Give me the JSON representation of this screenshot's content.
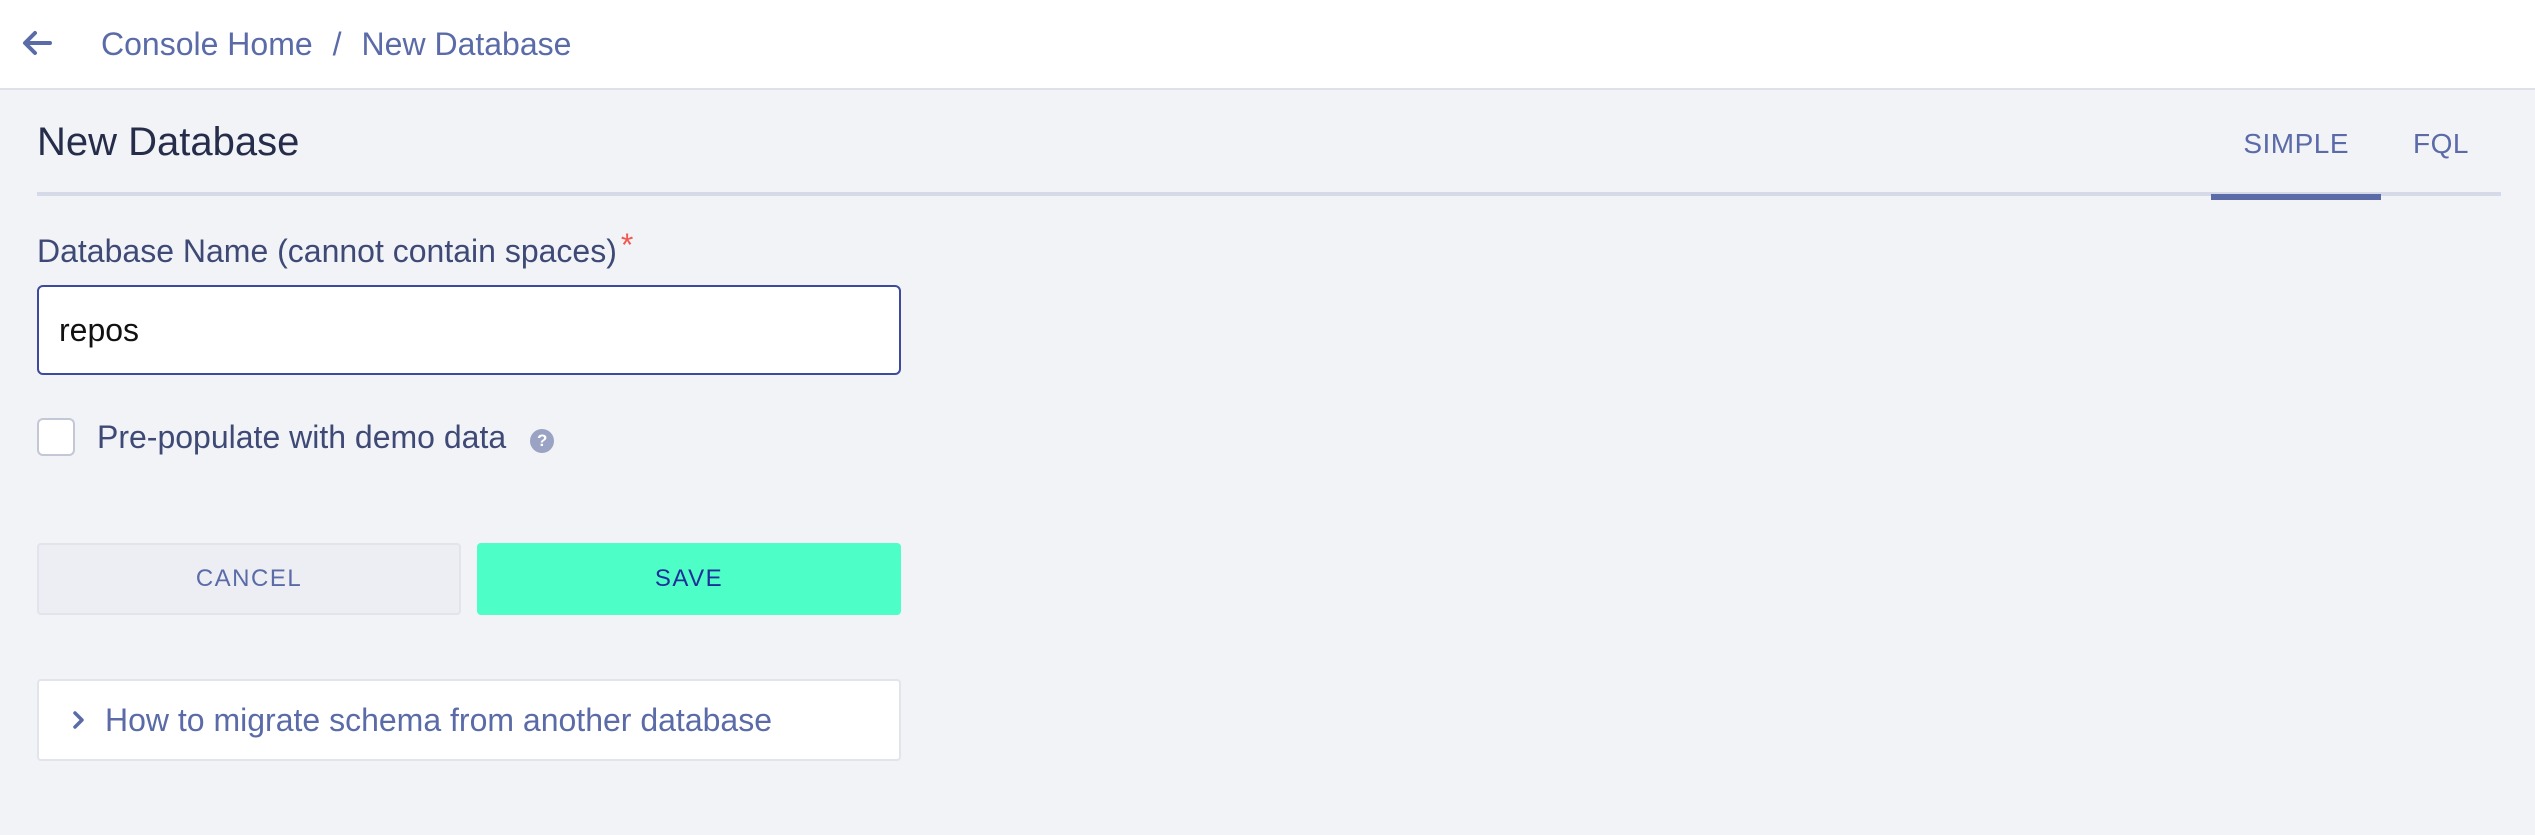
{
  "header": {
    "back_icon": "arrow-left-icon",
    "breadcrumb": {
      "home": "Console Home",
      "separator": "/",
      "current": "New Database"
    }
  },
  "page": {
    "title": "New Database",
    "tabs": [
      {
        "label": "SIMPLE",
        "active": true
      },
      {
        "label": "FQL",
        "active": false
      }
    ]
  },
  "form": {
    "name_label": "Database Name (cannot contain spaces)",
    "required_mark": "*",
    "name_value": "repos",
    "demo_checkbox_label": "Pre-populate with demo data",
    "demo_checked": false,
    "help_icon": "question-circle-icon",
    "help_glyph": "?",
    "cancel_label": "CANCEL",
    "save_label": "SAVE"
  },
  "accordion": {
    "icon": "chevron-right-icon",
    "label": "How to migrate schema from another database"
  },
  "colors": {
    "accent": "#5a6ba8",
    "save_button": "#4dffc6",
    "required": "#f2584f",
    "background": "#f2f3f7"
  }
}
